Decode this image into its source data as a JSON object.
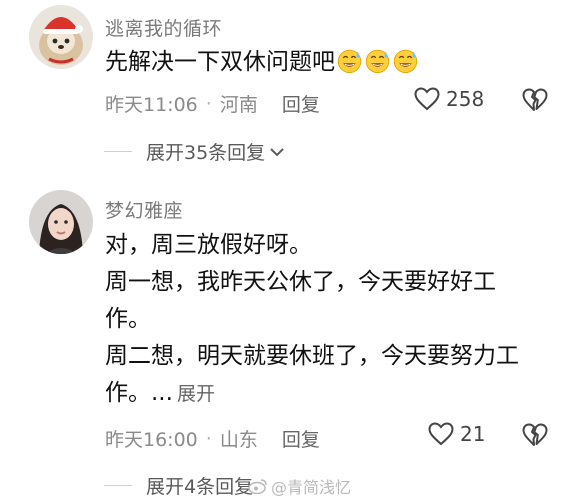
{
  "comments": [
    {
      "username": "逃离我的循环",
      "text_lines": [
        "先解决一下双休问题吧"
      ],
      "time": "昨天11:06",
      "location": "河南",
      "reply_label": "回复",
      "likes": "258",
      "expand_label": "展开35条回复",
      "avatar": "avatar-dog-with-red-hat"
    },
    {
      "username": "梦幻雅座",
      "text_lines": [
        "对，周三放假好呀。",
        "周一想，我昨天公休了，今天要好好工",
        "作。",
        "周二想，明天就要休班了，今天要努力工",
        "作。..."
      ],
      "inline_expand_label": "展开",
      "time": "昨天16:00",
      "location": "山东",
      "reply_label": "回复",
      "likes": "21",
      "expand_label": "展开4条回复",
      "avatar": "avatar-woman-photo"
    }
  ],
  "watermark": "@青简浅忆",
  "icons": {
    "like": "heart-outline-icon",
    "dislike": "broken-heart-icon",
    "expand": "chevron-down-icon",
    "emoji": "sweat-smile-emoji"
  }
}
